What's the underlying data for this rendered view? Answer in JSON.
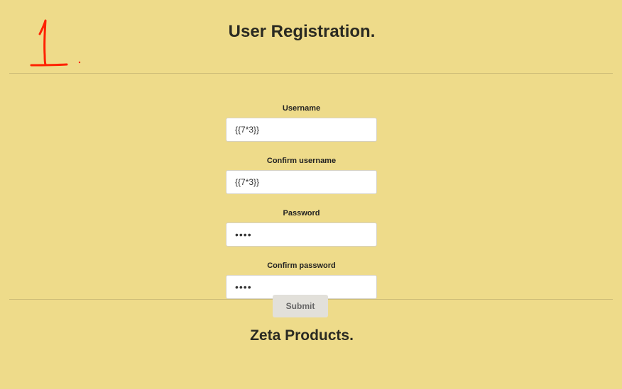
{
  "header": {
    "title": "User Registration."
  },
  "form": {
    "username": {
      "label": "Username",
      "value": "{{7*3}}"
    },
    "confirm_username": {
      "label": "Confirm username",
      "value": "{{7*3}}"
    },
    "password": {
      "label": "Password",
      "value": "abcd"
    },
    "confirm_password": {
      "label": "Confirm password",
      "value": "abcd"
    },
    "submit_label": "Submit"
  },
  "footer": {
    "title": "Zeta Products."
  },
  "colors": {
    "background": "#eedb8a",
    "annotation": "#ff2200",
    "button_bg": "#e2e0da"
  }
}
